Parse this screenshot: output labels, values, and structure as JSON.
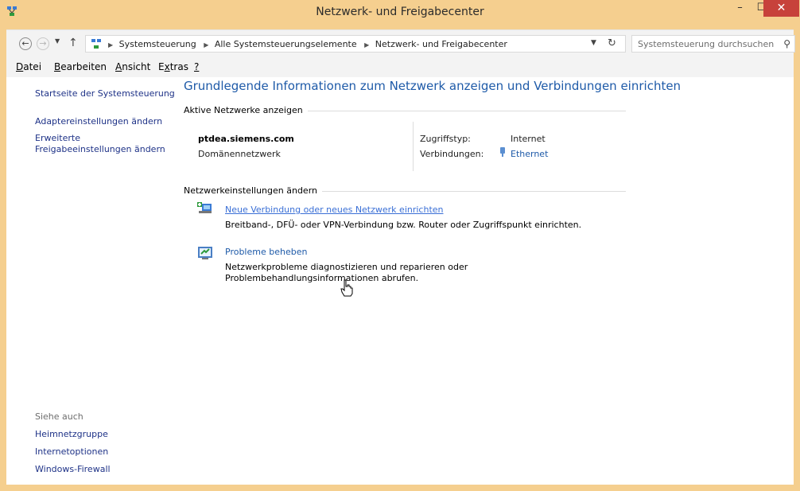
{
  "window": {
    "title": "Netzwerk- und Freigabecenter",
    "controls": {
      "minimize": "–",
      "maximize": "☐",
      "close": "✕"
    }
  },
  "navigation": {
    "back_glyph": "←",
    "forward_glyph": "→",
    "up_glyph": "↑",
    "breadcrumbs": [
      "Systemsteuerung",
      "Alle Systemsteuerungselemente",
      "Netzwerk- und Freigabecenter"
    ],
    "search_placeholder": "Systemsteuerung durchsuchen"
  },
  "menu": [
    {
      "underlined": "D",
      "rest": "atei"
    },
    {
      "underlined": "B",
      "rest": "earbeiten"
    },
    {
      "underlined": "A",
      "rest": "nsicht"
    },
    {
      "underlined": "x",
      "prefix": "E",
      "rest": "tras"
    },
    {
      "underlined": "?",
      "rest": ""
    }
  ],
  "sidebar": {
    "links": [
      "Startseite der Systemsteuerung",
      "Adaptereinstellungen ändern",
      "Erweiterte Freigabeeinstellungen ändern"
    ],
    "see_also_caption": "Siehe auch",
    "see_also": [
      "Heimnetzgruppe",
      "Internetoptionen",
      "Windows-Firewall"
    ]
  },
  "main": {
    "heading": "Grundlegende Informationen zum Netzwerk anzeigen und Verbindungen einrichten",
    "active_networks_title": "Aktive Netzwerke anzeigen",
    "network": {
      "name": "ptdea.siemens.com",
      "type": "Domänennetzwerk",
      "access_type_label": "Zugriffstyp:",
      "access_type_value": "Internet",
      "connections_label": "Verbindungen:",
      "connections_value": "Ethernet"
    },
    "change_settings_title": "Netzwerkeinstellungen ändern",
    "tasks": [
      {
        "link": "Neue Verbindung oder neues Netzwerk einrichten",
        "description": "Breitband-, DFÜ- oder VPN-Verbindung bzw. Router oder Zugriffspunkt einrichten."
      },
      {
        "link": "Probleme beheben",
        "description": "Netzwerkprobleme diagnostizieren und reparieren oder Problembehandlungsinformationen abrufen."
      }
    ]
  },
  "colors": {
    "frame": "#f5cf8f",
    "close": "#c7423b",
    "link": "#1e5aa8",
    "sidebar_link": "#1e3287"
  }
}
